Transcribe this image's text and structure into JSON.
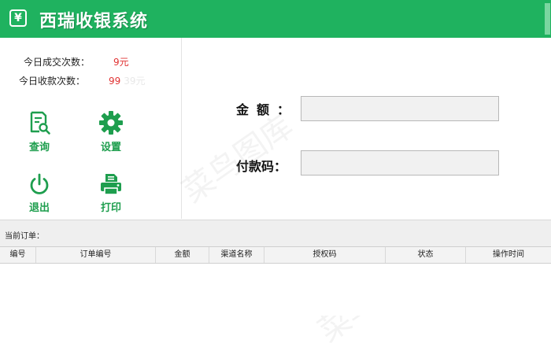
{
  "app": {
    "logo_symbol": "¥",
    "title": "西瑞收银系统"
  },
  "stats": {
    "today_transactions_label": "今日成交次数：",
    "today_transactions_value": "9元",
    "today_collections_label": "今日收款次数：",
    "today_collections_value": "99",
    "today_collections_faint": "39元"
  },
  "actions": {
    "query_label": "查询",
    "settings_label": "设置",
    "exit_label": "退出",
    "print_label": "打印"
  },
  "form": {
    "amount_label": "金额：",
    "amount_value": "",
    "code_label": "付款码：",
    "code_value": ""
  },
  "orders": {
    "title": "当前订单：",
    "columns": [
      "编号",
      "订单编号",
      "金额",
      "渠道名称",
      "授权码",
      "状态",
      "操作时间"
    ]
  },
  "colors": {
    "brand": "#1fb25f",
    "icon_green": "#1e9e4e",
    "highlight_red": "#e03232"
  }
}
